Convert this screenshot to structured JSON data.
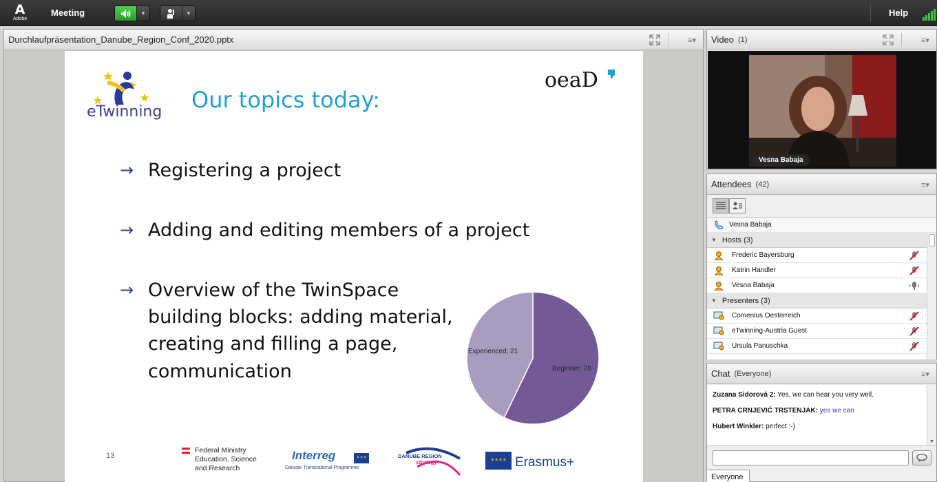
{
  "topbar": {
    "logo_text": "Adobe",
    "meeting_label": "Meeting",
    "help_label": "Help"
  },
  "share_pod": {
    "filename": "Durchlaufpräsentation_Danube_Region_Conf_2020.pptx"
  },
  "slide": {
    "title": "Our topics today:",
    "bullets": [
      "Registering a project",
      "Adding and editing members of a project",
      "Overview of the TwinSpace building blocks: adding material, creating and filling a page, communication"
    ],
    "bullet3_lines": [
      "Overview of the TwinSpace",
      "building blocks: adding material,",
      "creating and filling a page,",
      "communication"
    ],
    "page_number": "13",
    "logos": {
      "etwinning": "eTwinning",
      "oead": "OeAD",
      "ministry_line1": "Federal Ministry",
      "ministry_line2": "Education, Science",
      "ministry_line3": "and Research",
      "interreg": "Interreg",
      "interreg_sub": "Danube Transnational Programme",
      "danube_line1": "DANUBE REGION",
      "danube_line2": "strategy",
      "erasmus": "Erasmus+"
    }
  },
  "chart_data": {
    "type": "pie",
    "categories": [
      "Beginner",
      "Experienced"
    ],
    "values": [
      28,
      21
    ],
    "data_labels": [
      "Beginner; 28",
      "Experienced; 21"
    ],
    "colors": [
      "#735a96",
      "#a89cc0"
    ]
  },
  "video_pod": {
    "title": "Video",
    "count": "(1)",
    "participant_name": "Vesna Babaja"
  },
  "attendees_pod": {
    "title": "Attendees",
    "count": "(42)",
    "speaker": "Vesna Babaja",
    "hosts_label": "Hosts (3)",
    "hosts": [
      "Frederic Bayersburg",
      "Katrin Handler",
      "Vesna Babaja"
    ],
    "presenters_label": "Presenters (3)",
    "presenters": [
      "Comenius Oesterreich",
      "eTwinning-Austria Guest",
      "Ursula Panuschka"
    ]
  },
  "chat_pod": {
    "title": "Chat",
    "scope": "(Everyone)",
    "messages": [
      {
        "sender": "Zuzana Sidorová 2:",
        "text": "Yes, we can hear you very well."
      },
      {
        "sender": "PETRA CRNJEVIĆ TRSTENJAK:",
        "text": "yes we can"
      },
      {
        "sender": "Hubert Winkler:",
        "text": "perfect :-)"
      }
    ],
    "input_value": "",
    "tab_label": "Everyone"
  },
  "colors": {
    "slide_title": "#1fa0d8",
    "bullet_arrow": "#3b3f99",
    "pie_beginner": "#735a96",
    "pie_experienced": "#a89cc0",
    "chat_highlight": "#3a3ab8",
    "audio_active": "#3cc83c"
  }
}
